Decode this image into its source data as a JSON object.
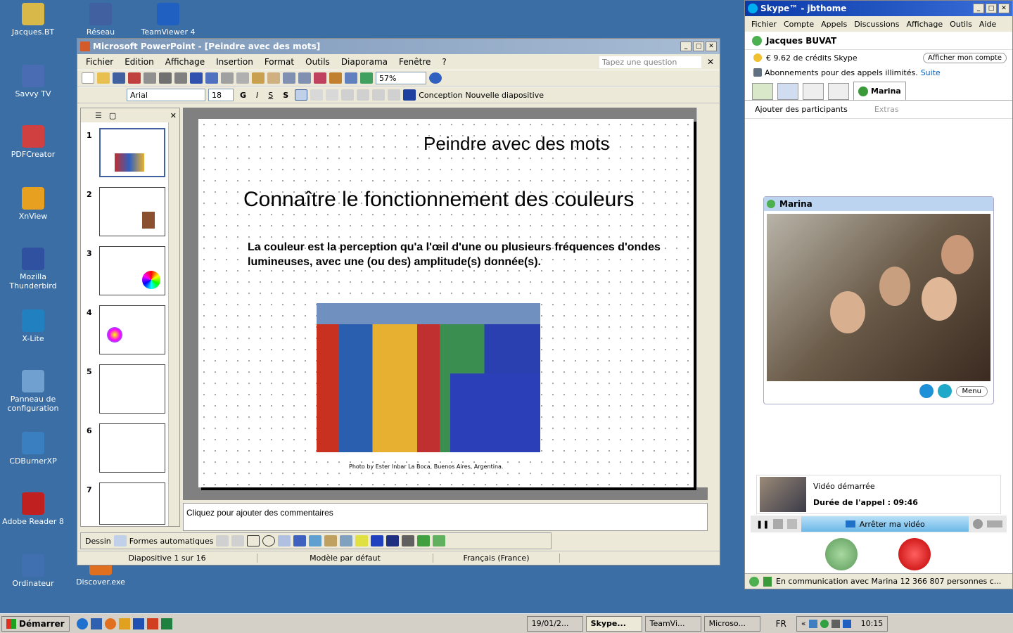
{
  "desktop_icons": [
    {
      "label": "Jacques.BT",
      "color": "#d9b84a"
    },
    {
      "label": "Savvy TV",
      "color": "#4a6cb3"
    },
    {
      "label": "PDFCreator",
      "color": "#d04040"
    },
    {
      "label": "XnView",
      "color": "#e8a020"
    },
    {
      "label": "Mozilla Thunderbird",
      "color": "#3050a0"
    },
    {
      "label": "X-Lite",
      "color": "#2080c0"
    },
    {
      "label": "Panneau de configuration",
      "color": "#70a0d0"
    },
    {
      "label": "CDBurnerXP",
      "color": "#3a80c0"
    },
    {
      "label": "Adobe Reader 8",
      "color": "#c02020"
    },
    {
      "label": "Ordinateur",
      "color": "#4070b0"
    },
    {
      "label": "Réseau",
      "color": "#4060a0"
    },
    {
      "label": "TeamViewer 4",
      "color": "#2060c0"
    },
    {
      "label": "Discover.exe",
      "color": "#e07020"
    }
  ],
  "ppt": {
    "title": "Microsoft PowerPoint - [Peindre avec des mots]",
    "menus": [
      "Fichier",
      "Edition",
      "Affichage",
      "Insertion",
      "Format",
      "Outils",
      "Diaporama",
      "Fenêtre",
      "?"
    ],
    "question_placeholder": "Tapez une question",
    "zoom": "57%",
    "font": "Arial",
    "font_size": "18",
    "bold": "G",
    "italic": "I",
    "underline": "S",
    "shadow": "S",
    "conception": "Conception",
    "new_slide": "Nouvelle diapositive",
    "slide_numbers": [
      "1",
      "2",
      "3",
      "4",
      "5",
      "6",
      "7"
    ],
    "slide": {
      "title": "Peindre avec des mots",
      "subtitle": "Connaître le fonctionnement des couleurs",
      "body": "La couleur est la perception qu'a l'œil d'une ou plusieurs fréquences d'ondes lumineuses, avec une (ou des) amplitude(s) donnée(s).",
      "caption": "Photo by Ester Inbar La Boca, Buenos Aires, Argentina."
    },
    "notes_placeholder": "Cliquez pour ajouter des commentaires",
    "draw_label": "Dessin",
    "autoshapes": "Formes automatiques",
    "status": {
      "slide": "Diapositive 1 sur 16",
      "template": "Modèle par défaut",
      "language": "Français (France)"
    }
  },
  "skype": {
    "title": "Skype™ - jbthome",
    "menus": [
      "Fichier",
      "Compte",
      "Appels",
      "Discussions",
      "Affichage",
      "Outils",
      "Aide"
    ],
    "user": "Jacques BUVAT",
    "credit": "€ 9.62 de crédits Skype",
    "account_button": "Afficher mon compte",
    "subscription": "Abonnements pour des appels illimités.",
    "subscription_link": "Suite",
    "call_tab": "Marina",
    "add_participants": "Ajouter des participants",
    "extras": "Extras",
    "video_name": "Marina",
    "menu_button": "Menu",
    "video_started": "Vidéo démarrée",
    "call_duration": "Durée de l'appel : 09:46",
    "stop_video": "Arrêter ma vidéo",
    "status_bar": "En communication avec Marina  12 366 807 personnes c..."
  },
  "taskbar": {
    "start": "Démarrer",
    "tasks": [
      "19/01/2...",
      "Skype...",
      "TeamVi...",
      "Microso..."
    ],
    "lang": "FR",
    "clock": "10:15"
  }
}
